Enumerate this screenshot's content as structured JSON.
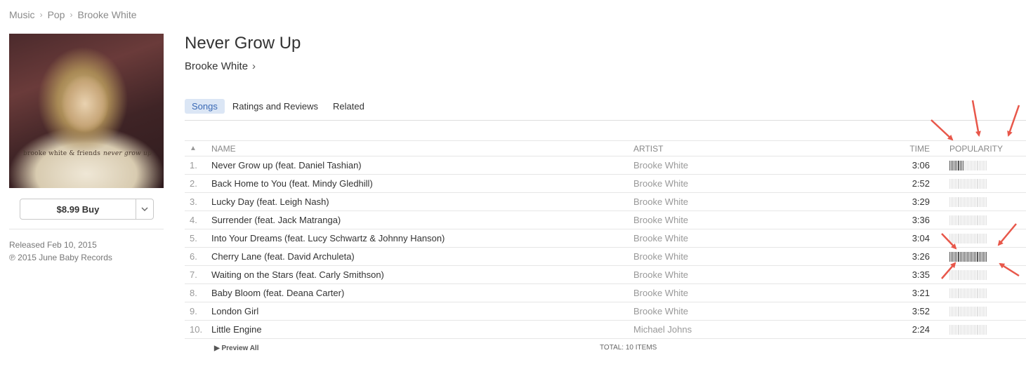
{
  "breadcrumb": [
    "Music",
    "Pop",
    "Brooke White"
  ],
  "album": {
    "title": "Never Grow Up",
    "artist": "Brooke White",
    "cover_caption_main": "brooke white & friends",
    "cover_caption_sub": "never grow up",
    "buy_label": "$8.99 Buy",
    "released": "Released Feb 10, 2015",
    "copyright": "℗ 2015 June Baby Records"
  },
  "tabs": [
    "Songs",
    "Ratings and Reviews",
    "Related"
  ],
  "table": {
    "headers": {
      "sort": "▲",
      "name": "NAME",
      "artist": "ARTIST",
      "time": "TIME",
      "popularity": "POPULARITY"
    },
    "rows": [
      {
        "num": "1.",
        "name": "Never Grow up (feat. Daniel Tashian)",
        "artist": "Brooke White",
        "time": "3:06",
        "popularity": 0.4
      },
      {
        "num": "2.",
        "name": "Back Home to You (feat. Mindy Gledhill)",
        "artist": "Brooke White",
        "time": "2:52",
        "popularity": 0.0
      },
      {
        "num": "3.",
        "name": "Lucky Day (feat. Leigh Nash)",
        "artist": "Brooke White",
        "time": "3:29",
        "popularity": 0.0
      },
      {
        "num": "4.",
        "name": "Surrender (feat. Jack Matranga)",
        "artist": "Brooke White",
        "time": "3:36",
        "popularity": 0.0
      },
      {
        "num": "5.",
        "name": "Into Your Dreams (feat. Lucy Schwartz & Johnny Hanson)",
        "artist": "Brooke White",
        "time": "3:04",
        "popularity": 0.0
      },
      {
        "num": "6.",
        "name": "Cherry Lane (feat. David Archuleta)",
        "artist": "Brooke White",
        "time": "3:26",
        "popularity": 1.0
      },
      {
        "num": "7.",
        "name": "Waiting on the Stars (feat. Carly Smithson)",
        "artist": "Brooke White",
        "time": "3:35",
        "popularity": 0.0
      },
      {
        "num": "8.",
        "name": "Baby Bloom (feat. Deana Carter)",
        "artist": "Brooke White",
        "time": "3:21",
        "popularity": 0.0
      },
      {
        "num": "9.",
        "name": "London Girl",
        "artist": "Brooke White",
        "time": "3:52",
        "popularity": 0.0
      },
      {
        "num": "10.",
        "name": "Little Engine",
        "artist": "Michael Johns",
        "time": "2:24",
        "popularity": 0.0
      }
    ]
  },
  "footer": {
    "preview_all": "Preview All",
    "total": "TOTAL: 10 ITEMS"
  },
  "colors": {
    "accent_tab_bg": "#dbe6f5",
    "accent_tab_text": "#3a69b5",
    "arrow": "#e8574a"
  }
}
